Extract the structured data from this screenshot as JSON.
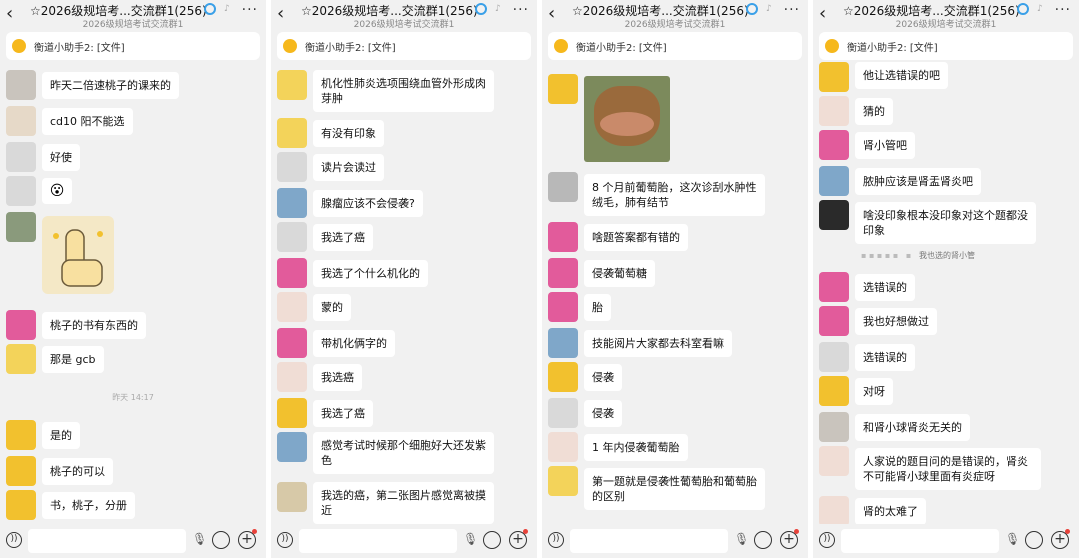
{
  "panels": [
    {
      "header": {
        "title": "☆2026级规培考...交流群1(256)",
        "subtitle": "2026级规培考试交流群1"
      },
      "notice": "衡道小助手2: [文件]",
      "messages": [
        {
          "text": "昨天二倍速桃子的课来的"
        },
        {
          "text": "cd10 阳不能选"
        },
        {
          "text": "好使"
        },
        {
          "text": "😮"
        },
        {
          "text": "桃子的书有东西的"
        },
        {
          "text": "那是 gcb"
        },
        {
          "text": "是的"
        },
        {
          "text": "桃子的可以"
        },
        {
          "text": "书，桃子，分册"
        }
      ],
      "time": "昨天 14:17"
    },
    {
      "header": {
        "title": "☆2026级规培考...交流群1(256)",
        "subtitle": "2026级规培考试交流群1"
      },
      "notice": "衡道小助手2: [文件]",
      "messages": [
        {
          "text": "机化性肺炎选项围绕血管外形成肉芽肿"
        },
        {
          "text": "有没有印象"
        },
        {
          "text": "读片会读过"
        },
        {
          "text": "腺瘤应该不会侵袭?"
        },
        {
          "text": "我选了癌"
        },
        {
          "text": "我选了个什么机化的"
        },
        {
          "text": "蒙的"
        },
        {
          "text": "带机化俩字的"
        },
        {
          "text": "我选癌"
        },
        {
          "text": "我选了癌"
        },
        {
          "text": "感觉考试时候那个细胞好大还发紫色"
        },
        {
          "text": "我选的癌，第二张图片感觉离被摸近"
        }
      ]
    },
    {
      "header": {
        "title": "☆2026级规培考...交流群1(256)",
        "subtitle": "2026级规培考试交流群1"
      },
      "notice": "衡道小助手2: [文件]",
      "messages": [
        {
          "text": "8 个月前葡萄胎，这次诊刮水肿性绒毛，肺有结节"
        },
        {
          "text": "啥题答案都有错的"
        },
        {
          "text": "侵袭葡萄糖"
        },
        {
          "text": "胎"
        },
        {
          "text": "技能阅片大家都去科室看嘛"
        },
        {
          "text": "侵袭"
        },
        {
          "text": "侵袭"
        },
        {
          "text": "1 年内侵袭葡萄胎"
        },
        {
          "text": "第一题就是侵袭性葡萄胎和葡萄胎的区别"
        }
      ]
    },
    {
      "header": {
        "title": "☆2026级规培考...交流群1(256)",
        "subtitle": "2026级规培考试交流群1"
      },
      "notice": "衡道小助手2: [文件]",
      "messages": [
        {
          "text": "他让选错误的吧"
        },
        {
          "text": "猜的"
        },
        {
          "text": "肾小管吧"
        },
        {
          "text": "脓肿应该是肾盂肾炎吧"
        },
        {
          "text": "啥没印象根本没印象对这个题都没印象"
        },
        {
          "text": "选错误的"
        },
        {
          "text": "我也好想做过"
        },
        {
          "text": "选错误的"
        },
        {
          "text": "对呀"
        },
        {
          "text": "和肾小球肾炎无关的"
        },
        {
          "text": "人家说的题目问的是错误的，肾炎不可能肾小球里面有炎症呀"
        },
        {
          "text": "肾的太难了"
        }
      ],
      "quote": "我也选的肾小管"
    }
  ]
}
